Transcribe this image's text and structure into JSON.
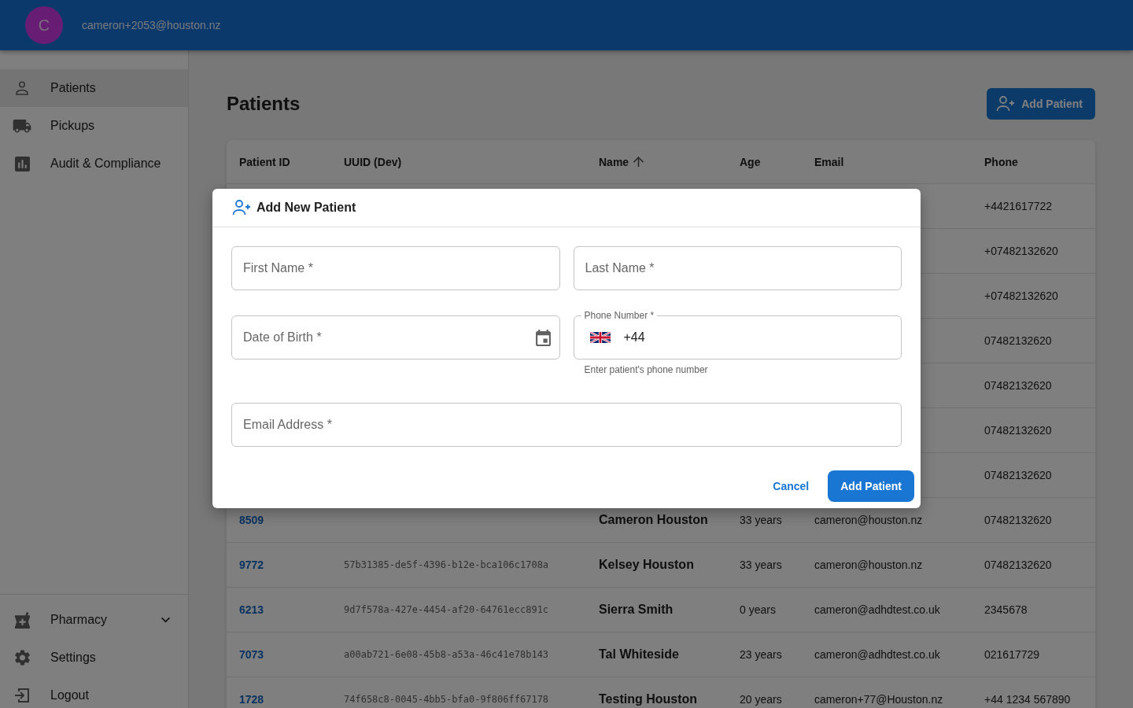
{
  "app_bar": {
    "avatar_letter": "C",
    "user_email": "cameron+2053@houston.nz"
  },
  "sidebar": {
    "items": [
      {
        "label": "Patients",
        "selected": true
      },
      {
        "label": "Pickups",
        "selected": false
      },
      {
        "label": "Audit & Compliance",
        "selected": false
      }
    ],
    "pharmacy_group": {
      "label": "Pharmacy",
      "expanded": false
    },
    "footer_items": [
      {
        "label": "Settings"
      },
      {
        "label": "Logout"
      }
    ]
  },
  "page": {
    "title": "Patients",
    "add_button": "Add Patient"
  },
  "table": {
    "columns": [
      {
        "label": "Patient ID",
        "sorted": false
      },
      {
        "label": "UUID (Dev)",
        "sorted": false
      },
      {
        "label": "Name",
        "sorted": true
      },
      {
        "label": "Age",
        "sorted": false
      },
      {
        "label": "Email",
        "sorted": false
      },
      {
        "label": "Phone",
        "sorted": false
      }
    ],
    "rows": [
      {
        "phone": "+4421617722"
      },
      {
        "phone": "+07482132620"
      },
      {
        "phone": "+07482132620"
      },
      {
        "phone": "07482132620"
      },
      {
        "phone": "07482132620"
      },
      {
        "phone": "07482132620"
      },
      {
        "phone": "07482132620"
      },
      {
        "patient_id": "8509",
        "name": "Cameron Houston",
        "age": "33 years",
        "email": "cameron@houston.nz",
        "phone": "07482132620"
      },
      {
        "patient_id": "9772",
        "uuid": "57b31385-de5f-4396-b12e-bca106c1708a",
        "name": "Kelsey Houston",
        "age": "33 years",
        "email": "cameron@houston.nz",
        "phone": "07482132620"
      },
      {
        "patient_id": "6213",
        "uuid": "9d7f578a-427e-4454-af20-64761ecc891c",
        "name": "Sierra Smith",
        "age": "0 years",
        "email": "cameron@adhdtest.co.uk",
        "phone": "2345678"
      },
      {
        "patient_id": "7073",
        "uuid": "a00ab721-6e08-45b8-a53a-46c41e78b143",
        "name": "Tal Whiteside",
        "age": "23 years",
        "email": "cameron@adhdtest.co.uk",
        "phone": "021617729"
      },
      {
        "patient_id": "1728",
        "uuid": "74f658c8-0045-4bb5-bfa0-9f806ff67178",
        "name": "Testing Houston",
        "age": "20 years",
        "email": "cameron+77@Houston.nz",
        "phone": "+44 1234 567890"
      }
    ]
  },
  "dialog": {
    "title": "Add New Patient",
    "field_rows": [
      {
        "fields": [
          {
            "kind": "text",
            "placeholder": "First Name *"
          },
          {
            "kind": "text",
            "placeholder": "Last Name *"
          }
        ]
      },
      {
        "fields": [
          {
            "kind": "date",
            "placeholder": "Date of Birth *"
          },
          {
            "kind": "phone",
            "label": "Phone Number *",
            "value": "+44",
            "helper": "Enter patient's phone number"
          }
        ]
      },
      {
        "fields": [
          {
            "kind": "text",
            "placeholder": "Email Address *"
          }
        ]
      }
    ],
    "actions": [
      {
        "kind": "text",
        "label": "Cancel"
      },
      {
        "kind": "contained",
        "label": "Add Patient"
      }
    ]
  }
}
